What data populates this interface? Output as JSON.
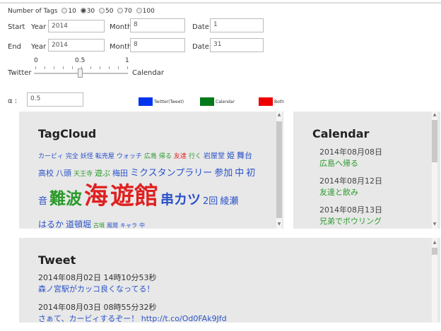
{
  "tags_filter": {
    "label": "Number of Tags",
    "options": [
      "10",
      "30",
      "50",
      "70",
      "100"
    ],
    "selected": "30"
  },
  "start": {
    "label": "Start",
    "year_label": "Year",
    "year": "2014",
    "month_label": "Month",
    "month": "8",
    "date_label": "Date",
    "date": "1"
  },
  "end": {
    "label": "End",
    "year_label": "Year",
    "year": "2014",
    "month_label": "Month",
    "month": "8",
    "date_label": "Date",
    "date": "31"
  },
  "slider": {
    "ticks": [
      "0",
      "0.5",
      "1"
    ],
    "left_label": "Twitter",
    "right_label": "Calendar",
    "value": 0.5
  },
  "alpha": {
    "label": "α :",
    "value": "0.5"
  },
  "legend": [
    {
      "label": "Twitter(Tweet)",
      "color": "#0000ff"
    },
    {
      "label": "Calendar",
      "color": "#008000"
    },
    {
      "label": "Both",
      "color": "#ff0000"
    }
  ],
  "tagcloud": {
    "title": "TagCloud",
    "lines": [
      [
        {
          "t": "カービィ",
          "c": "#2a52c8",
          "s": 9
        },
        {
          "t": "完全",
          "c": "#2a52c8",
          "s": 9
        },
        {
          "t": "妖怪",
          "c": "#2a52c8",
          "s": 9
        },
        {
          "t": "転売屋",
          "c": "#2a52c8",
          "s": 9
        },
        {
          "t": "ウォッチ",
          "c": "#2a52c8",
          "s": 9
        },
        {
          "t": "広島",
          "c": "#2a9a2a",
          "s": 9
        },
        {
          "t": "帰る",
          "c": "#2a9a2a",
          "s": 9
        },
        {
          "t": "友達",
          "c": "#e02020",
          "s": 9
        },
        {
          "t": "行く",
          "c": "#2a9a2a",
          "s": 9
        },
        {
          "t": "岩屋堂",
          "c": "#2a52c8",
          "s": 10
        },
        {
          "t": "姫",
          "c": "#2a52c8",
          "s": 11
        },
        {
          "t": "舞台",
          "c": "#2a52c8",
          "s": 11
        }
      ],
      [
        {
          "t": "高校",
          "c": "#2a52c8",
          "s": 11
        },
        {
          "t": "八頭",
          "c": "#2a52c8",
          "s": 11
        },
        {
          "t": "天王寺",
          "c": "#2a9a2a",
          "s": 9
        },
        {
          "t": "遊ぶ",
          "c": "#2a9a2a",
          "s": 11
        },
        {
          "t": "梅田",
          "c": "#2a52c8",
          "s": 11
        },
        {
          "t": "ミクスタンプラリー",
          "c": "#2a52c8",
          "s": 13
        },
        {
          "t": "参加",
          "c": "#2a52c8",
          "s": 13
        },
        {
          "t": "中",
          "c": "#2a52c8",
          "s": 13
        },
        {
          "t": "初",
          "c": "#2a52c8",
          "s": 13
        }
      ],
      [
        {
          "t": "音",
          "c": "#2a52c8",
          "s": 13
        },
        {
          "t": "難波",
          "c": "#2a9a2a",
          "s": 23
        },
        {
          "t": "海",
          "c": "#e02020",
          "s": 34
        },
        {
          "t": "遊館",
          "c": "#e02020",
          "s": 34
        },
        {
          "t": "串カツ",
          "c": "#2a52c8",
          "s": 19
        },
        {
          "t": "2回",
          "c": "#2a52c8",
          "s": 13
        },
        {
          "t": "綾瀬",
          "c": "#2a52c8",
          "s": 13
        }
      ],
      [
        {
          "t": "はるか",
          "c": "#2a52c8",
          "s": 12
        },
        {
          "t": "道頓堀",
          "c": "#2a52c8",
          "s": 12
        },
        {
          "t": "古墳",
          "c": "#2a9a2a",
          "s": 8
        },
        {
          "t": "風鬩",
          "c": "#2a52c8",
          "s": 8
        },
        {
          "t": "キャラ",
          "c": "#2a52c8",
          "s": 8
        },
        {
          "t": "中",
          "c": "#2a52c8",
          "s": 8
        }
      ]
    ]
  },
  "calendar": {
    "title": "Calendar",
    "events": [
      {
        "date": "2014年08月08日",
        "text": "広島へ帰る"
      },
      {
        "date": "2014年08月12日",
        "text": "友達と飲み"
      },
      {
        "date": "2014年08月13日",
        "text": "兄弟でボウリング"
      }
    ]
  },
  "tweets": {
    "title": "Tweet",
    "items": [
      {
        "date": "2014年08月02日 14時10分53秒",
        "text": "森ノ宮駅がカッコ良くなってる！"
      },
      {
        "date": "2014年08月03日 08時55分32秒",
        "text": "さぁて、カービィするぞー！ http://t.co/Od0FAk9Jfd"
      }
    ]
  }
}
